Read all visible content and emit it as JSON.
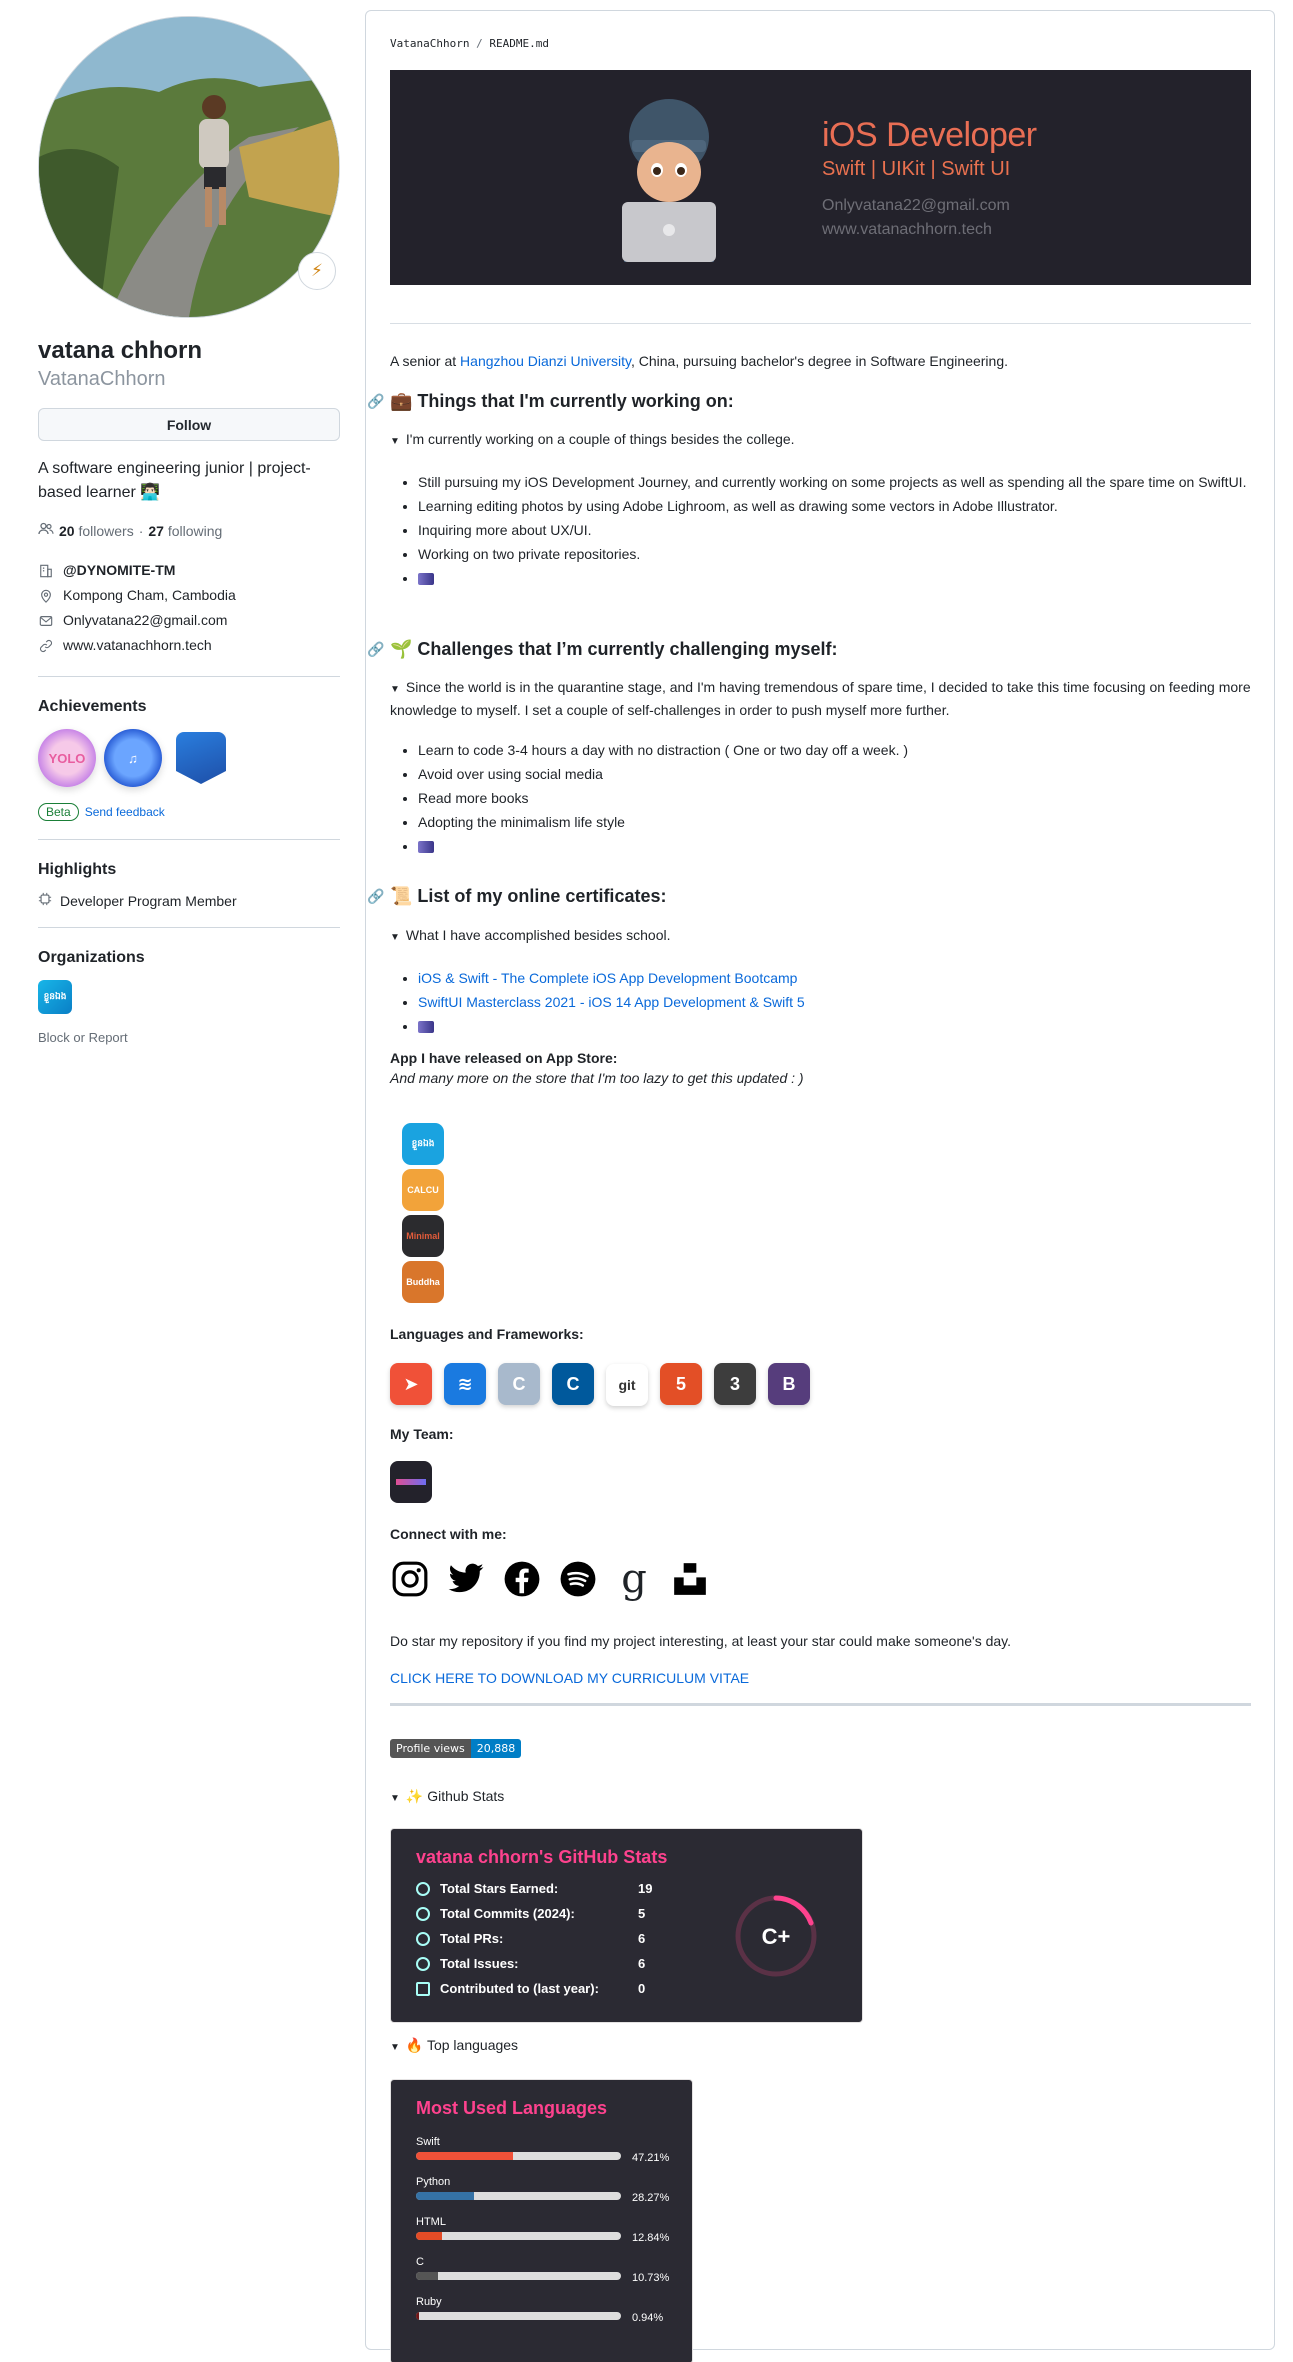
{
  "profile": {
    "full_name": "vatana chhorn",
    "login": "VatanaChhorn",
    "follow_label": "Follow",
    "bio": "A software engineering junior  | project-based learner 👨🏻‍💻",
    "followers_count": "20",
    "followers_label": "followers",
    "dot": "·",
    "following_count": "27",
    "following_label": "following",
    "org_handle": "@DYNOMITE-TM",
    "location": "Kompong Cham, Cambodia",
    "email": "Onlyvatana22@gmail.com",
    "website": "www.vatanachhorn.tech"
  },
  "achievements": {
    "heading": "Achievements",
    "badges": [
      "yolo-badge",
      "shark-badge",
      "pull-shark-badge"
    ],
    "beta_label": "Beta",
    "feedback_label": "Send feedback"
  },
  "highlights": {
    "heading": "Highlights",
    "item": "Developer Program Member"
  },
  "organizations": {
    "heading": "Organizations",
    "org_logo_text": "ខ្លួនឯង"
  },
  "block_report": "Block or Report",
  "readme": {
    "crumb_owner": "VatanaChhorn",
    "crumb_sep": "/",
    "crumb_file": "README.md",
    "banner": {
      "title": "iOS Developer",
      "subtitle": "Swift | UIKit | Swift UI",
      "email": "Onlyvatana22@gmail.com",
      "site": "www.vatanachhorn.tech"
    },
    "intro_prefix": "A senior at ",
    "intro_link": "Hangzhou Dianzi University",
    "intro_suffix": ", China, pursuing bachelor's degree in Software Engineering.",
    "sec1": {
      "title": "💼 Things that I'm currently working on:",
      "summary": "I'm currently working on a couple of things besides the college.",
      "items": [
        "Still pursuing my iOS Development Journey, and currently working on some projects as well as spending all the spare time on SwiftUI.",
        "Learning editing photos by using Adobe Lighroom, as well as drawing some vectors in Adobe Illustrator.",
        "Inquiring more about UX/UI.",
        "Working on two private repositories."
      ]
    },
    "sec2": {
      "title": "🌱 Challenges that I’m currently challenging myself:",
      "summary": "Since the world is in the quarantine stage, and I'm having tremendous of spare time, I decided to take this time focusing on feeding more knowledge to myself. I set a couple of self-challenges in order to push myself more further.",
      "items": [
        "Learn to code 3-4 hours a day with no distraction ( One or two day off a week. )",
        "Avoid over using social media",
        "Read more books",
        "Adopting the minimalism life style"
      ]
    },
    "sec3": {
      "title": "📜 List of my online certificates:",
      "summary": "What I have accomplished besides school.",
      "items": [
        "iOS & Swift - The Complete iOS App Development Bootcamp",
        "SwiftUI Masterclass 2021 - iOS 14 App Development & Swift 5"
      ]
    },
    "apps_heading": "App I have released on App Store:",
    "apps_note": "And many more on the store that I'm too lazy to get this updated : )",
    "apps": [
      {
        "name": "ខ្លួនឯង",
        "color": "#1aa3e0"
      },
      {
        "name": "CALCU",
        "color": "#f2a33a"
      },
      {
        "name": "Minimal",
        "color": "#2b2b2e"
      },
      {
        "name": "Buddha",
        "color": "#d9762b"
      }
    ],
    "languages_heading": "Languages and Frameworks:",
    "tech": [
      {
        "name": "swift-icon",
        "color": "#f05138",
        "label": ""
      },
      {
        "name": "swiftui-icon",
        "color": "#1a7ae0",
        "label": ""
      },
      {
        "name": "c-icon",
        "color": "#a8b9cc",
        "label": "C"
      },
      {
        "name": "cplusplus-icon",
        "color": "#00599c",
        "label": "C"
      },
      {
        "name": "git-icon",
        "color": "#ffffff",
        "label": "git"
      },
      {
        "name": "html5-icon",
        "color": "#e34f26",
        "label": "5"
      },
      {
        "name": "css3-icon",
        "color": "#3d3d3d",
        "label": "3"
      },
      {
        "name": "bootstrap-icon",
        "color": "#563d7c",
        "label": "B"
      }
    ],
    "team_heading": "My Team:",
    "connect_heading": "Connect with me:",
    "socials": [
      "instagram-icon",
      "twitter-icon",
      "facebook-icon",
      "spotify-icon",
      "goodreads-icon",
      "unsplash-icon"
    ],
    "star_note": "Do star my repository if you find my project interesting, at least your star could make someone's day.",
    "cv_link": "CLICK HERE TO DOWNLOAD MY CURRICULUM VITAE",
    "views_label": "Profile views",
    "views_count": "20,888",
    "github_stats_summary": "✨ Github Stats",
    "stats_card": {
      "title": "vatana chhorn's GitHub Stats",
      "rows": [
        {
          "label": "Total Stars Earned:",
          "value": "19"
        },
        {
          "label": "Total Commits (2024):",
          "value": "5"
        },
        {
          "label": "Total PRs:",
          "value": "6"
        },
        {
          "label": "Total Issues:",
          "value": "6"
        },
        {
          "label": "Contributed to (last year):",
          "value": "0"
        }
      ],
      "grade": "C+"
    },
    "top_lang_summary": "🔥 Top languages",
    "lang_card": {
      "title": "Most Used Languages",
      "langs": [
        {
          "name": "Swift",
          "pct": "47.21%",
          "value": 47.21,
          "color": "#F05138"
        },
        {
          "name": "Python",
          "pct": "28.27%",
          "value": 28.27,
          "color": "#3572A5"
        },
        {
          "name": "HTML",
          "pct": "12.84%",
          "value": 12.84,
          "color": "#e34c26"
        },
        {
          "name": "C",
          "pct": "10.73%",
          "value": 10.73,
          "color": "#555555"
        },
        {
          "name": "Ruby",
          "pct": "0.94%",
          "value": 0.94,
          "color": "#701516"
        }
      ]
    }
  }
}
